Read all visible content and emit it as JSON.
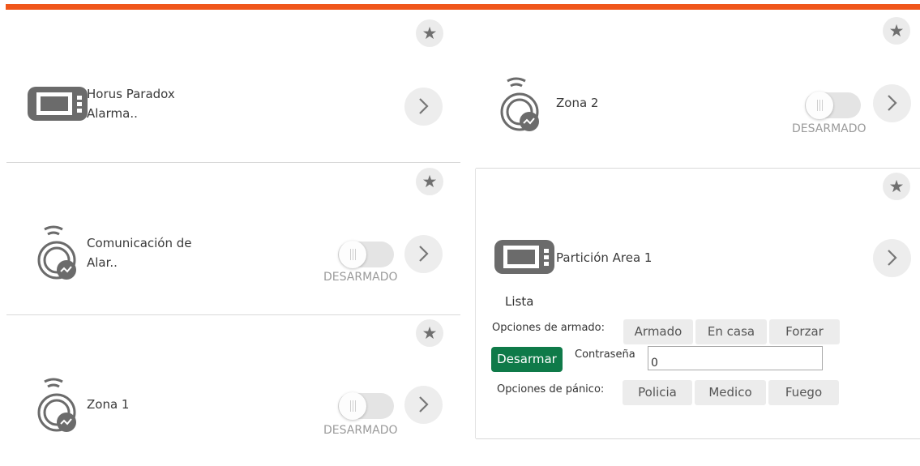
{
  "devices": {
    "horus": {
      "name_line1": "Horus Paradox",
      "name_line2": "Alarma..",
      "icon": "alarm-panel-icon"
    },
    "comunicacion": {
      "name_line1": "Comunicación de",
      "name_line2": "Alar..",
      "status": "DESARMADO",
      "armed": false,
      "icon": "wireless-zone-icon"
    },
    "zona1": {
      "name": "Zona 1",
      "status": "DESARMADO",
      "armed": false,
      "icon": "wireless-zone-icon"
    },
    "zona2": {
      "name": "Zona 2",
      "status": "DESARMADO",
      "armed": false,
      "icon": "wireless-zone-icon"
    },
    "particion": {
      "name": "Partición Area 1",
      "icon": "alarm-panel-icon",
      "state": "Lista",
      "arm_label": "Opciones de armado:",
      "arm_options": [
        "Armado",
        "En casa",
        "Forzar"
      ],
      "disarm_label": "Desarmar",
      "password_label": "Contraseña",
      "password_value": "0",
      "panic_label": "Opciones de pánico:",
      "panic_options": [
        "Policia",
        "Medico",
        "Fuego"
      ]
    }
  },
  "colors": {
    "accent": "#f0561b",
    "disarm": "#0f7a49"
  }
}
